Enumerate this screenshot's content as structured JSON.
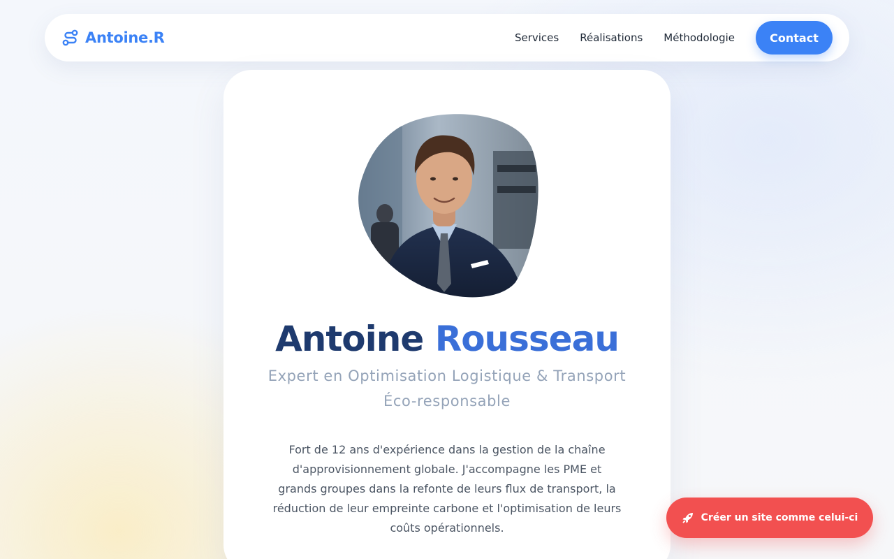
{
  "brand": {
    "name": "Antoine.R",
    "icon": "route-icon",
    "color": "#3b82f6"
  },
  "nav": {
    "links": [
      "Services",
      "Réalisations",
      "Méthodologie"
    ],
    "contact_label": "Contact"
  },
  "hero": {
    "first_name": "Antoine",
    "last_name": "Rousseau",
    "subtitle": "Expert en Optimisation Logistique & Transport Éco-responsable",
    "bio": "Fort de 12 ans d'expérience dans la gestion de la chaîne d'approvisionnement globale. J'accompagne les PME et grands groupes dans la refonte de leurs flux de transport, la réduction de leur empreinte carbone et l'optimisation de leurs coûts opérationnels.",
    "avatar": "portrait-photo"
  },
  "cta": {
    "label": "Créer un site comme celui-ci",
    "icon": "rocket-icon",
    "color": "#f25050"
  }
}
